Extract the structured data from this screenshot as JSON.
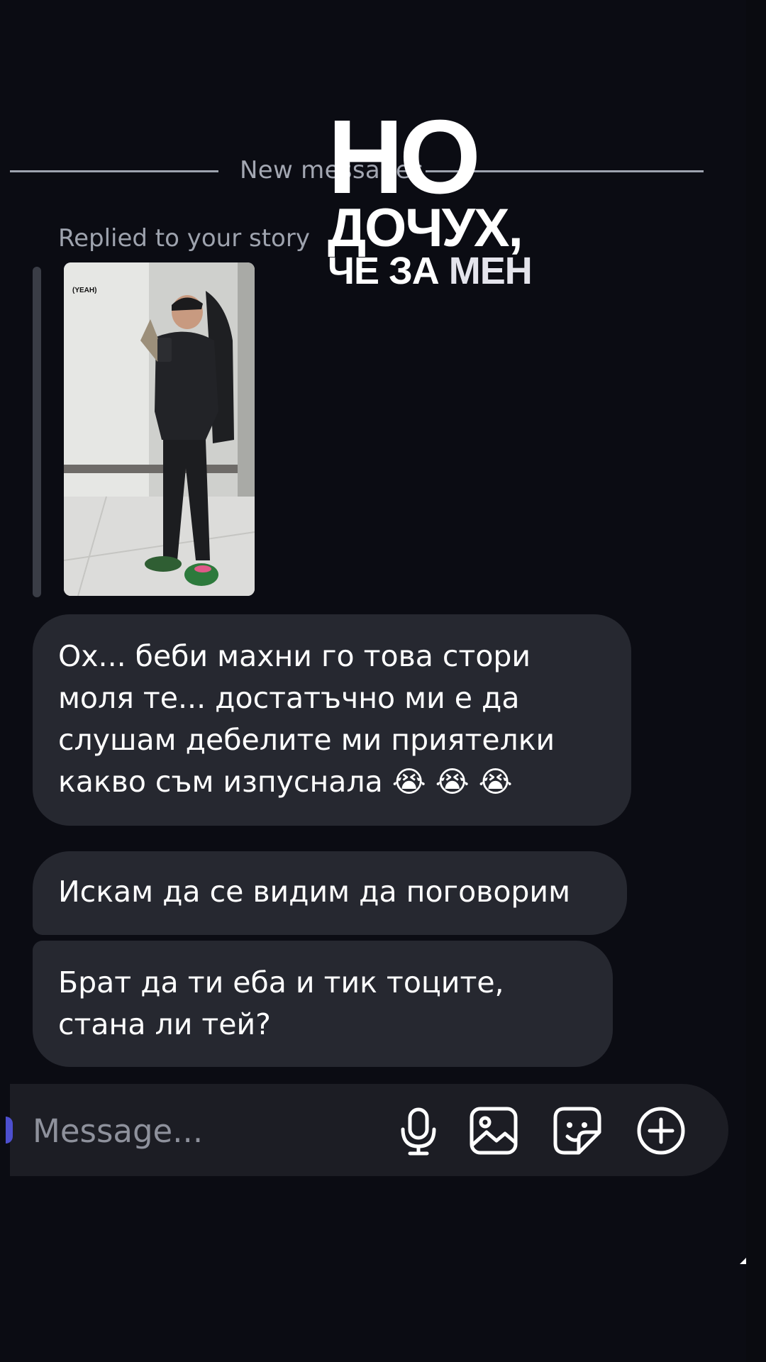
{
  "divider": {
    "label": "New messages"
  },
  "overlay": {
    "line1": "НО",
    "line2": "ДОЧУХ,",
    "line3a": "ЧЕ ЗА ",
    "line3b": "МЕН"
  },
  "reply": {
    "label": "Replied to your story",
    "story_tag": "(YEAH)"
  },
  "messages": [
    {
      "text": "Ох... беби махни го това стори моля те... достатъчно ми е да слушам дебелите ми приятелки какво съм изпуснала 😭 😭 😭"
    },
    {
      "text": "Искам да се видим да поговорим"
    },
    {
      "text": "Брат да ти еба и тик тоците, стана ли тей?"
    }
  ],
  "composer": {
    "placeholder": "Message...",
    "icons": [
      "microphone-icon",
      "image-icon",
      "sticker-icon",
      "add-icon"
    ]
  },
  "colors": {
    "background": "#0b0c13",
    "bubble": "#262830",
    "composer": "#1c1d24",
    "accent": "#4d4fcf"
  }
}
